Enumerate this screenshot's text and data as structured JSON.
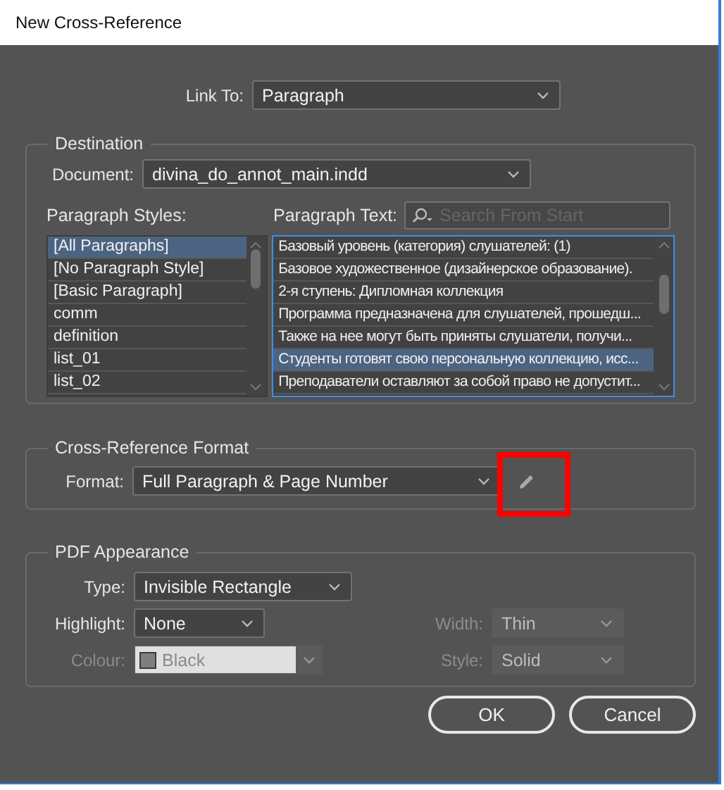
{
  "window": {
    "title": "New Cross-Reference"
  },
  "link_to": {
    "label": "Link To:",
    "value": "Paragraph"
  },
  "destination": {
    "legend": "Destination",
    "document": {
      "label": "Document:",
      "value": "divina_do_annot_main.indd"
    },
    "styles_label": "Paragraph Styles:",
    "styles": [
      {
        "label": "[All Paragraphs]",
        "selected": true
      },
      {
        "label": "[No Paragraph Style]",
        "selected": false
      },
      {
        "label": "[Basic Paragraph]",
        "selected": false
      },
      {
        "label": "comm",
        "selected": false
      },
      {
        "label": "definition",
        "selected": false
      },
      {
        "label": "list_01",
        "selected": false
      },
      {
        "label": "list_02",
        "selected": false
      }
    ],
    "text_label": "Paragraph Text:",
    "search": {
      "placeholder": "Search From Start"
    },
    "paragraphs": [
      {
        "text": "Базовый уровень (категория) слушателей: (1)",
        "selected": false
      },
      {
        "text": "Базовое художественное (дизайнерское образование).",
        "selected": false
      },
      {
        "text": "2-я ступень: Дипломная коллекция",
        "selected": false
      },
      {
        "text": "Программа предназначена для слушателей, прошедш...",
        "selected": false
      },
      {
        "text": "Также на нее могут быть приняты слушатели, получи...",
        "selected": false
      },
      {
        "text": "Студенты готовят свою персональную коллекцию, исс...",
        "selected": true
      },
      {
        "text": "Преподаватели оставляют за собой право не допустит...",
        "selected": false
      }
    ]
  },
  "format": {
    "legend": "Cross-Reference Format",
    "label": "Format:",
    "value": "Full Paragraph & Page Number",
    "edit_highlighted": true
  },
  "pdf": {
    "legend": "PDF Appearance",
    "type": {
      "label": "Type:",
      "value": "Invisible Rectangle",
      "disabled": false
    },
    "highlight": {
      "label": "Highlight:",
      "value": "None",
      "disabled": false
    },
    "width": {
      "label": "Width:",
      "value": "Thin",
      "disabled": true
    },
    "colour": {
      "label": "Colour:",
      "value": "Black",
      "disabled": true
    },
    "style": {
      "label": "Style:",
      "value": "Solid",
      "disabled": true
    }
  },
  "buttons": [
    {
      "label": "OK"
    },
    {
      "label": "Cancel"
    }
  ]
}
